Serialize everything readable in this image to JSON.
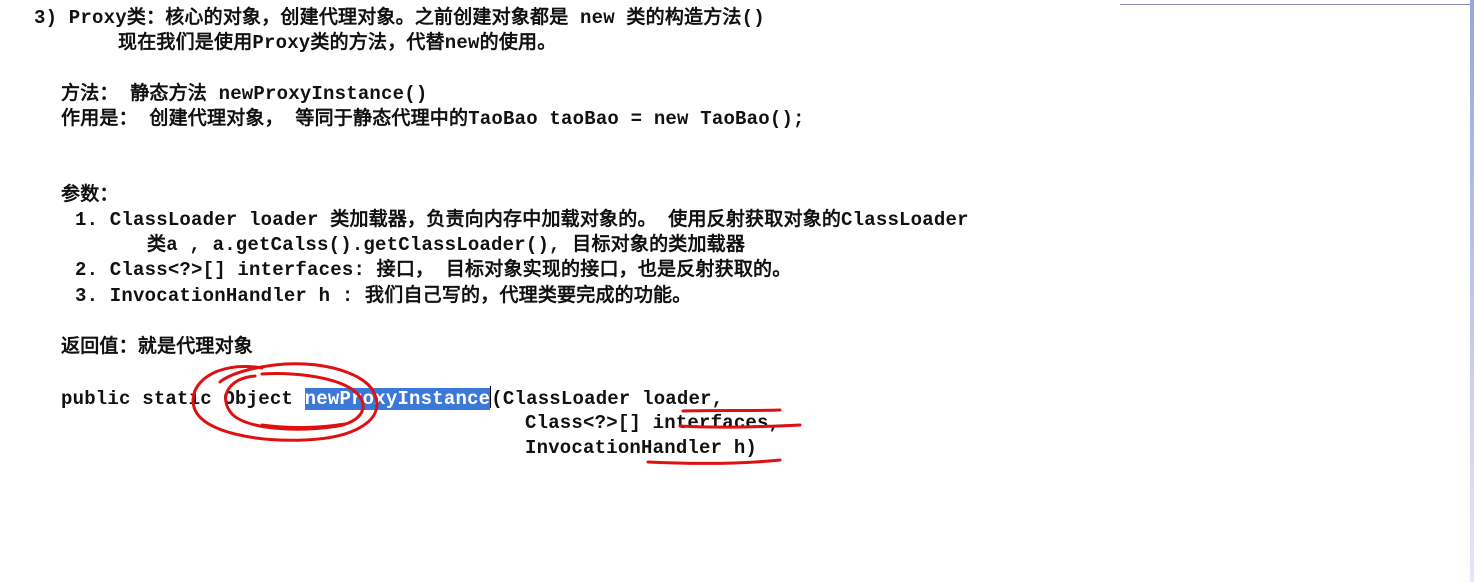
{
  "content": {
    "l1": "3) Proxy类：核心的对象，创建代理对象。之前创建对象都是 new 类的构造方法()",
    "l2": "现在我们是使用Proxy类的方法，代替new的使用。",
    "l3": "方法： 静态方法 newProxyInstance()",
    "l4": "作用是： 创建代理对象， 等同于静态代理中的TaoBao taoBao = new TaoBao();",
    "l5": "参数：",
    "l6": "1. ClassLoader loader 类加载器，负责向内存中加载对象的。 使用反射获取对象的ClassLoader",
    "l7": "类a , a.getCalss().getClassLoader(), 目标对象的类加载器",
    "l8": "2. Class<?>[] interfaces: 接口， 目标对象实现的接口，也是反射获取的。",
    "l9": "3. InvocationHandler h : 我们自己写的，代理类要完成的功能。",
    "l10": "返回值：就是代理对象",
    "sig_prefix": "public static Object ",
    "sig_method": "newProxyInstance",
    "sig_suffix": "(ClassLoader loader,",
    "sig_line2": "Class<?>[] interfaces,",
    "sig_line3": "InvocationHandler h)"
  },
  "colors": {
    "highlight": "#3b78d8",
    "ink": "#e01010",
    "text": "#111111"
  }
}
